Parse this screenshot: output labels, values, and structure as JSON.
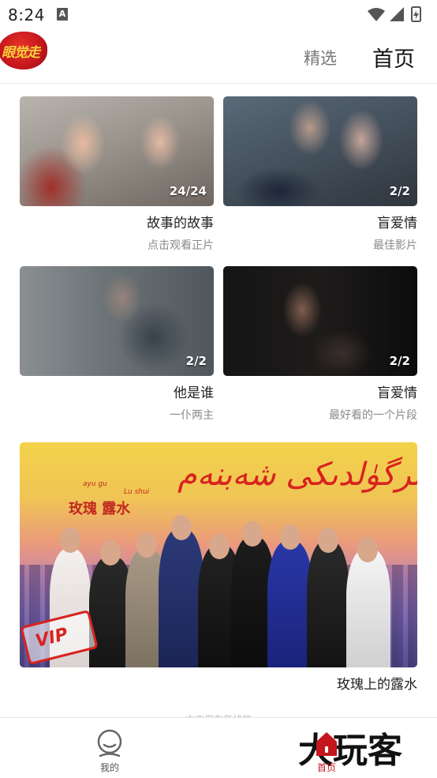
{
  "status_bar": {
    "time": "8:24",
    "notification_icon": "A"
  },
  "header": {
    "logo_text": "眼觉走",
    "tabs": [
      {
        "label": "精选",
        "active": false
      },
      {
        "label": "首页",
        "active": true
      }
    ]
  },
  "cards": [
    {
      "title": "故事的故事",
      "subtitle": "点击观看正片",
      "count": "24/24"
    },
    {
      "title": "盲爱情",
      "subtitle": "最佳影片",
      "count": "2/2"
    },
    {
      "title": "他是谁",
      "subtitle": "一仆两主",
      "count": "2/2"
    },
    {
      "title": "盲爱情",
      "subtitle": "最好看的一个片段",
      "count": "2/2"
    }
  ],
  "banner": {
    "title": "玫瑰上的露水",
    "script_text": "ئەتىرگۈلدىكى شەبنەم",
    "logo_text": "玫瑰 露水",
    "logo_small_1": "ayu gu",
    "logo_small_2": "Lu shui",
    "vip_label": "VIP"
  },
  "footer_hint": "本应用在年线的",
  "bottom_nav": {
    "items": [
      {
        "label": "我的",
        "icon": "profile-icon",
        "active": false
      },
      {
        "label": "首页",
        "icon": "home-icon",
        "active": true
      }
    ]
  },
  "watermark_text": "大玩客",
  "colors": {
    "accent_red": "#c4161c",
    "text_primary": "#222222",
    "text_secondary": "#8a8a8a"
  }
}
